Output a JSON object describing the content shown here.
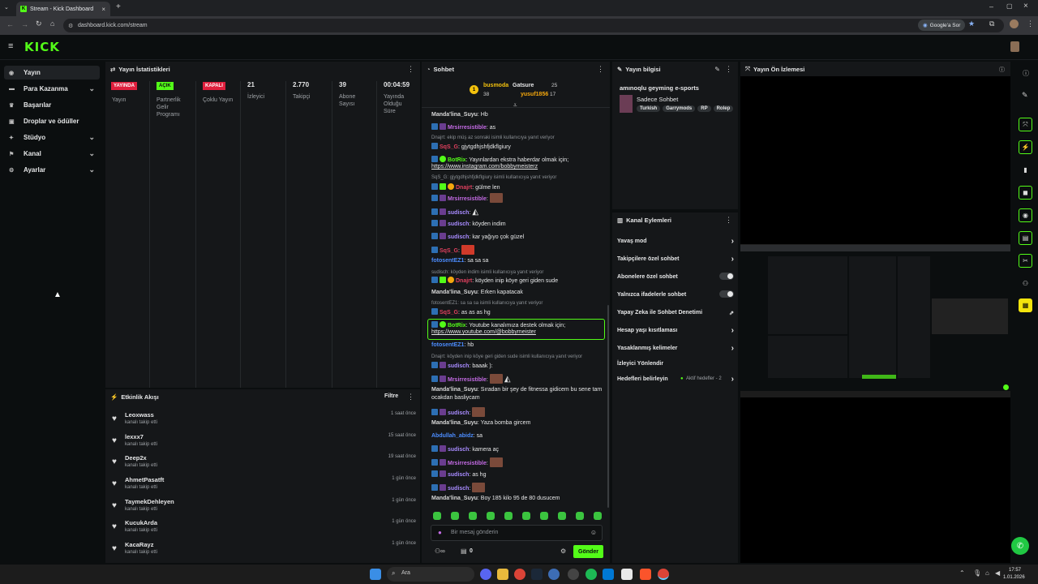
{
  "browser": {
    "tab_title": "Stream - Kick Dashboard",
    "url": "dashboard.kick.com/stream",
    "google_btn": "Google'a Sor"
  },
  "kick": {
    "logo": "KICK"
  },
  "sidebar": {
    "items": [
      {
        "label": "Yayın",
        "icon": "broadcast-icon",
        "chevron": false
      },
      {
        "label": "Para Kazanma",
        "icon": "money-icon",
        "chevron": true
      },
      {
        "label": "Başarılar",
        "icon": "trophy-icon",
        "chevron": false
      },
      {
        "label": "Droplar ve ödüller",
        "icon": "gift-icon",
        "chevron": false
      },
      {
        "label": "Stüdyo",
        "icon": "studio-icon",
        "chevron": true
      },
      {
        "label": "Kanal",
        "icon": "channel-icon",
        "chevron": true
      },
      {
        "label": "Ayarlar",
        "icon": "gear-icon",
        "chevron": true
      }
    ]
  },
  "stats": {
    "title": "Yayın İstatistikleri",
    "cols": [
      {
        "tag": "YAYINDA",
        "label": "Yayın"
      },
      {
        "tag": "AÇIK",
        "label": "Partnerlik Gelir Programı"
      },
      {
        "tag": "KAPALI",
        "label": "Çoklu Yayın"
      },
      {
        "value": "21",
        "label": "İzleyici"
      },
      {
        "value": "2.770",
        "label": "Takipçi"
      },
      {
        "value": "39",
        "label": "Abone Sayısı"
      },
      {
        "value": "00:04:59",
        "label": "Yayında Olduğu Süre"
      }
    ]
  },
  "feed": {
    "title": "Etkinlik Akışı",
    "filter": "Filtre",
    "items": [
      {
        "name": "Leoxwass",
        "sub": "kanalı takip etti",
        "time": "1 saat önce"
      },
      {
        "name": "lexxx7",
        "sub": "kanalı takip etti",
        "time": "15 saat önce"
      },
      {
        "name": "Deep2x",
        "sub": "kanalı takip etti",
        "time": "19 saat önce"
      },
      {
        "name": "AhmetPasatft",
        "sub": "kanalı takip etti",
        "time": "1 gün önce"
      },
      {
        "name": "TaymekDehleyen",
        "sub": "kanalı takip etti",
        "time": "1 gün önce"
      },
      {
        "name": "KucukArda",
        "sub": "kanalı takip etti",
        "time": "1 gün önce"
      },
      {
        "name": "KacaRayz",
        "sub": "kanalı takip etti",
        "time": "1 gün önce"
      }
    ]
  },
  "chat": {
    "title": "Sohbet",
    "leaders": [
      {
        "name": "busmoda",
        "count": "38"
      },
      {
        "name": "Gatsure",
        "count": "25"
      },
      {
        "name": "yusuf1856",
        "count": "17"
      }
    ],
    "messages": [
      {
        "type": "msg",
        "user": "Manda'lina_Suyu",
        "color": "#d8d8d8",
        "text": ": Hb"
      },
      {
        "type": "msg",
        "user": "Mrsirresistible",
        "color": "#c56be6",
        "text": ": as"
      },
      {
        "type": "reply",
        "text": "Dnajrt: ekip müş az sonraki isimli kullanıcıya yanıt veriyor"
      },
      {
        "type": "msg",
        "user": "SqS_G",
        "color": "#e0405e",
        "text": ": gjytgdhjshfjdkflgiury"
      },
      {
        "type": "msg",
        "user": "BotRix",
        "color": "#53fc18",
        "text": ": Yayınlardan ekstra haberdar olmak için;"
      },
      {
        "type": "link",
        "text": "https://www.instagram.com/bobbymeisterz"
      },
      {
        "type": "reply",
        "text": "SqS_G: gjytgdhjshfjdkflgiury isimli kullanıcıya yanıt veriyor"
      },
      {
        "type": "msg",
        "user": "Dnajrt",
        "color": "#e0405e",
        "text": ": gülme len"
      },
      {
        "type": "msg",
        "user": "Mrsirresistible",
        "color": "#c56be6",
        "text": ":"
      },
      {
        "type": "msg",
        "user": "sudisch",
        "color": "#a88bff",
        "text": ":"
      },
      {
        "type": "msg",
        "user": "sudisch",
        "color": "#a88bff",
        "text": ": köyden indim"
      },
      {
        "type": "msg",
        "user": "sudisch",
        "color": "#a88bff",
        "text": ": kar yağıyo çok güzel"
      },
      {
        "type": "msg",
        "user": "SqS_G",
        "color": "#e0405e",
        "text": ":"
      },
      {
        "type": "msg",
        "user": "fotosentEZ1",
        "color": "#4c8dff",
        "text": ": sa sa sa"
      },
      {
        "type": "reply",
        "text": "sudisch: köyden indim isimli kullanıcıya yanıt veriyor"
      },
      {
        "type": "msg",
        "user": "Dnajrt",
        "color": "#e0405e",
        "text": ": köyden inip köye geri giden sude"
      },
      {
        "type": "msg",
        "user": "Manda'lina_Suyu",
        "color": "#d8d8d8",
        "text": ": Erken kapatacak"
      },
      {
        "type": "reply",
        "text": "fotosentEZ1: sa sa sa isimli kullanıcıya yanıt veriyor"
      },
      {
        "type": "msg",
        "user": "SqS_G",
        "color": "#e0405e",
        "text": ": as as as hg"
      },
      {
        "type": "msg",
        "user": "BotRix",
        "color": "#53fc18",
        "text": ": Youtube kanalımıza destek olmak için;"
      },
      {
        "type": "link",
        "text": "https://www.youtube.com/@bobbymeister"
      },
      {
        "type": "msg",
        "user": "fotosentEZ1",
        "color": "#4c8dff",
        "text": ": hb"
      },
      {
        "type": "reply",
        "text": "Dnajrt: köyden inip köye geri giden sude isimli kullanıcıya yanıt veriyor"
      },
      {
        "type": "msg",
        "user": "sudisch",
        "color": "#a88bff",
        "text": ": baaak ):"
      },
      {
        "type": "msg",
        "user": "Mrsirresistible",
        "color": "#c56be6",
        "text": ":"
      },
      {
        "type": "msg",
        "user": "Manda'lina_Suyu",
        "color": "#d8d8d8",
        "text": ": Sıradan bir şey de fitnessa gidicem bu sene tam"
      },
      {
        "type": "cont",
        "text": "ocakdan basliycam"
      },
      {
        "type": "msg",
        "user": "sudisch",
        "color": "#a88bff",
        "text": ":"
      },
      {
        "type": "msg",
        "user": "Manda'lina_Suyu",
        "color": "#d8d8d8",
        "text": ": Yaza bomba gircem"
      },
      {
        "type": "msg",
        "user": "Abdullah_abidz",
        "color": "#4c8dff",
        "text": ": sa"
      },
      {
        "type": "msg",
        "user": "sudisch",
        "color": "#a88bff",
        "text": ": kamera aç"
      },
      {
        "type": "msg",
        "user": "Mrsirresistible",
        "color": "#c56be6",
        "text": ":"
      },
      {
        "type": "msg",
        "user": "sudisch",
        "color": "#a88bff",
        "text": ": as hg"
      },
      {
        "type": "msg",
        "user": "sudisch",
        "color": "#a88bff",
        "text": ":"
      },
      {
        "type": "msg",
        "user": "Manda'lina_Suyu",
        "color": "#d8d8d8",
        "text": ": Boy 185 kilo 95 de 80 dusucem"
      }
    ],
    "input_placeholder": "Bir mesaj gönderin",
    "send": "Gönder",
    "count": "0"
  },
  "info": {
    "title": "Yayın bilgisi",
    "stream_title": "amınoqlu geyming e-sports",
    "category": "Sadece Sohbet",
    "tags": [
      "Turkish",
      "Garrymods",
      "RP",
      "Rolep"
    ]
  },
  "channel_actions": {
    "title": "Kanal Eylemleri",
    "items": [
      {
        "label": "Yavaş mod",
        "ctl": "arrow"
      },
      {
        "label": "Takipçilere özel sohbet",
        "ctl": "arrow"
      },
      {
        "label": "Abonelere özel sohbet",
        "ctl": "toggle"
      },
      {
        "label": "Yalnızca ifadelerle sohbet",
        "ctl": "toggle"
      },
      {
        "label": "Yapay Zeka ile Sohbet Denetimi",
        "ctl": "ext"
      },
      {
        "label": "Hesap yaşı kısıtlaması",
        "ctl": "arrow"
      },
      {
        "label": "Yasaklanmış kelimeler",
        "ctl": "arrow"
      },
      {
        "label": "İzleyici Yönlendir",
        "ctl": "none"
      },
      {
        "label": "Hedefleri belirleyin",
        "ctl": "goal"
      }
    ],
    "goal_text": "Aktif hedefler - 2"
  },
  "preview": {
    "title": "Yayın Ön İzlemesi"
  },
  "taskbar": {
    "search": "Ara",
    "time": "17:57",
    "date": "1.01.2026"
  },
  "colors": {
    "accent": "#53fc18",
    "bg": "#0b0e0f",
    "panel": "#151719"
  }
}
